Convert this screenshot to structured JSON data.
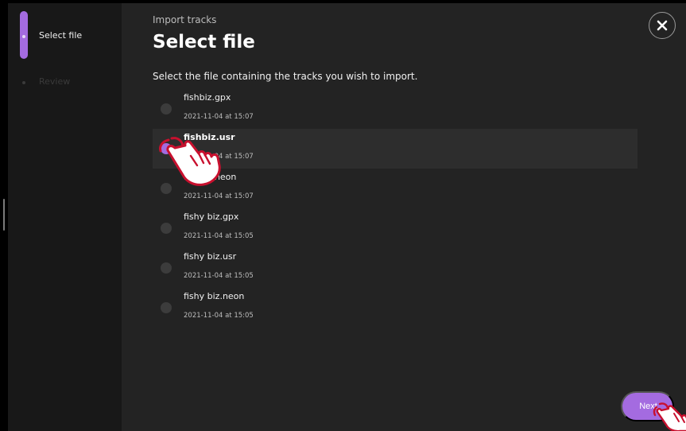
{
  "stepper": {
    "steps": [
      {
        "label": "Select file",
        "state": "active"
      },
      {
        "label": "Review",
        "state": "inactive"
      }
    ]
  },
  "dialog": {
    "subtitle": "Import tracks",
    "title": "Select file",
    "instruction": "Select the file containing the tracks you wish to import."
  },
  "files": [
    {
      "name": "fishbiz.gpx",
      "date": "2021-11-04 at 15:07",
      "selected": false
    },
    {
      "name": "fishbiz.usr",
      "date": "2021-11-04 at 15:07",
      "selected": true
    },
    {
      "name": "fishbiz.neon",
      "date": "2021-11-04 at 15:07",
      "selected": false
    },
    {
      "name": "fishy biz.gpx",
      "date": "2021-11-04 at 15:05",
      "selected": false
    },
    {
      "name": "fishy biz.usr",
      "date": "2021-11-04 at 15:05",
      "selected": false
    },
    {
      "name": "fishy biz.neon",
      "date": "2021-11-04 at 15:05",
      "selected": false
    }
  ],
  "actions": {
    "next_label": "Next",
    "close_icon": "close-icon"
  },
  "colors": {
    "accent": "#a46be0",
    "pointer_outline": "#c8102e"
  }
}
